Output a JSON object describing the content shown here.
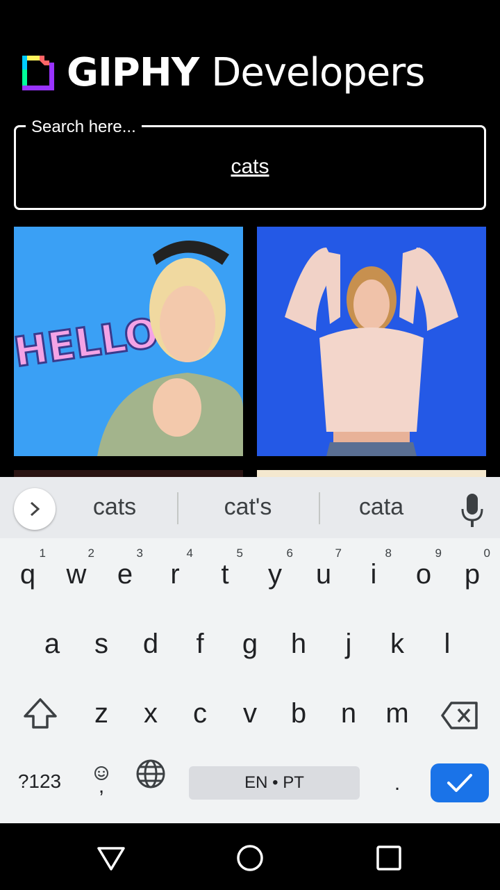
{
  "header": {
    "brand": "GIPHY",
    "sub": "Developers"
  },
  "search": {
    "legend": "Search here...",
    "value": "cats"
  },
  "gifs": [
    {
      "name": "gif-hello-woman",
      "label": "HELLO"
    },
    {
      "name": "gif-cheering-woman"
    },
    {
      "name": "gif-partial-1"
    },
    {
      "name": "gif-partial-2"
    }
  ],
  "keyboard": {
    "suggestions": [
      "cats",
      "cat's",
      "cata"
    ],
    "row1": [
      {
        "ch": "q",
        "hint": "1"
      },
      {
        "ch": "w",
        "hint": "2"
      },
      {
        "ch": "e",
        "hint": "3"
      },
      {
        "ch": "r",
        "hint": "4"
      },
      {
        "ch": "t",
        "hint": "5"
      },
      {
        "ch": "y",
        "hint": "6"
      },
      {
        "ch": "u",
        "hint": "7"
      },
      {
        "ch": "i",
        "hint": "8"
      },
      {
        "ch": "o",
        "hint": "9"
      },
      {
        "ch": "p",
        "hint": "0"
      }
    ],
    "row2": [
      "a",
      "s",
      "d",
      "f",
      "g",
      "h",
      "j",
      "k",
      "l"
    ],
    "row3": [
      "z",
      "x",
      "c",
      "v",
      "b",
      "n",
      "m"
    ],
    "symbols_label": "?123",
    "comma": ",",
    "period": ".",
    "space_label": "EN • PT"
  },
  "colors": {
    "accent": "#1a73e8",
    "keyboard_bg": "#f1f3f4",
    "suggest_bg": "#e8eaed"
  }
}
